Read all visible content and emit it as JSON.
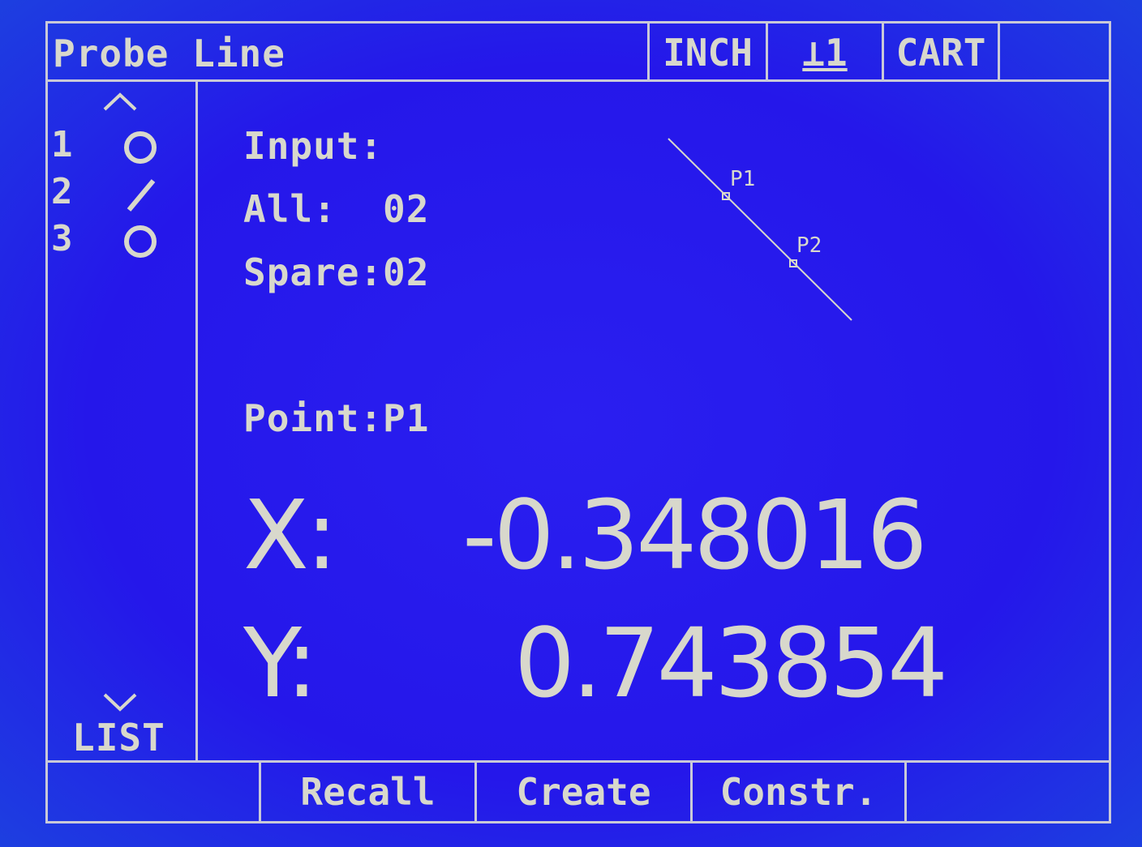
{
  "header": {
    "title": "Probe Line",
    "unit": "INCH",
    "datum": "1",
    "coord_mode": "CART"
  },
  "sidebar": {
    "items": [
      {
        "index": "1",
        "icon": "circle-icon"
      },
      {
        "index": "2",
        "icon": "line-icon"
      },
      {
        "index": "3",
        "icon": "circle-icon"
      }
    ],
    "list_label": "LIST"
  },
  "main": {
    "input_label": "Input:",
    "all_label": "All:",
    "all_value": "02",
    "spare_label": "Spare:",
    "spare_value": "02",
    "point_label": "Point:",
    "point_value": "P1",
    "x_label": "X:",
    "x_value": "-0.348016",
    "y_label": "Y:",
    "y_value": "0.743854",
    "diagram": {
      "p1_label": "P1",
      "p2_label": "P2"
    }
  },
  "softkeys": {
    "recall": "Recall",
    "create": "Create",
    "constr": "Constr."
  },
  "colors": {
    "background": "#2517ea",
    "foreground": "#d8d8cc"
  }
}
